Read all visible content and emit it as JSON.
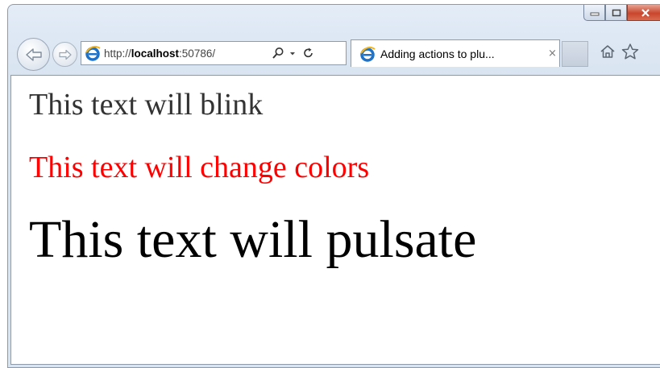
{
  "browser": {
    "address_url_prefix": "http://",
    "address_url_host": "localhost",
    "address_url_rest": ":50786/",
    "tab_title": "Adding actions to plu...",
    "tab_close": "×",
    "icons": [
      "back-arrow-icon",
      "forward-arrow-icon",
      "ie-logo-icon",
      "search-icon",
      "dropdown-icon",
      "refresh-icon",
      "home-icon",
      "favorites-star-icon",
      "minimize-icon",
      "maximize-icon",
      "close-icon"
    ]
  },
  "page": {
    "line1": "This text will blink",
    "line2": "This text will change colors",
    "line3": "This text will pulsate"
  },
  "colors": {
    "line2_color": "#ff0000",
    "close_button": "#c8462c"
  }
}
